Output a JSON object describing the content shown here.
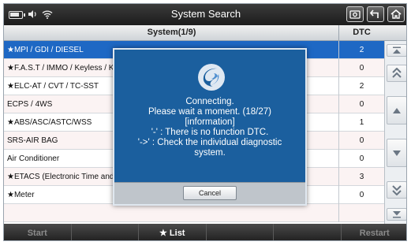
{
  "titlebar": {
    "title": "System Search",
    "status_icons": [
      "battery-icon",
      "volume-icon",
      "wifi-icon"
    ],
    "buttons": [
      "screenshot-icon",
      "back-icon",
      "home-icon"
    ]
  },
  "table": {
    "col_system": "System(1/9)",
    "col_dtc": "DTC",
    "rows": [
      {
        "name": "★MPI / GDI / DIESEL",
        "dtc": "2"
      },
      {
        "name": "★F.A.S.T / IMMO / Keyless / KOS",
        "dtc": "0"
      },
      {
        "name": "★ELC-AT / CVT / TC-SST",
        "dtc": "2"
      },
      {
        "name": "ECPS / 4WS",
        "dtc": "0"
      },
      {
        "name": "★ABS/ASC/ASTC/WSS",
        "dtc": "1"
      },
      {
        "name": "SRS-AIR BAG",
        "dtc": "0"
      },
      {
        "name": "Air Conditioner",
        "dtc": "0"
      },
      {
        "name": "★ETACS (Electronic Time and Alarm Control System)",
        "dtc": "3"
      },
      {
        "name": "★Meter",
        "dtc": "0"
      },
      {
        "name": "",
        "dtc": ""
      }
    ]
  },
  "bottombar": {
    "start": "Start",
    "b2": "",
    "list": "★ List",
    "b4": "",
    "b5": "",
    "restart": "Restart"
  },
  "dialog": {
    "lines": [
      "Connecting.",
      "Please wait a moment. (18/27)",
      "[information]",
      "'-'  : There is no function DTC.",
      "'->' : Check the individual diagnostic",
      "system."
    ],
    "cancel_label": "Cancel"
  },
  "colors": {
    "selected_row": "#1e68c4",
    "dialog_bg": "#1b5f9e"
  }
}
